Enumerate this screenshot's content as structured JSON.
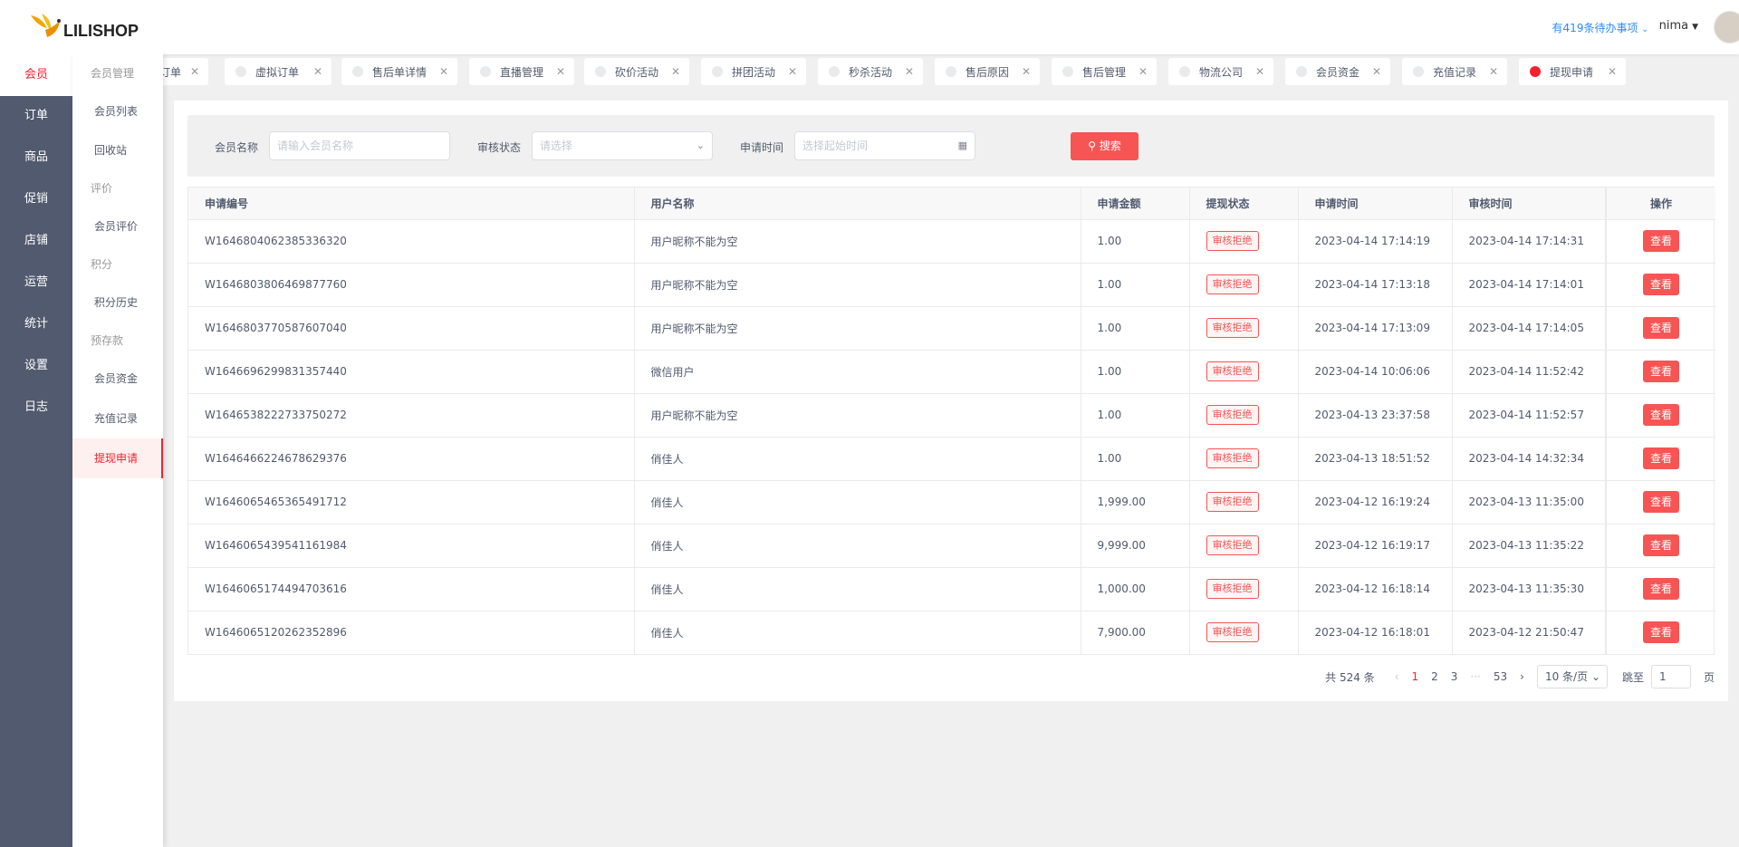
{
  "logo": {
    "text": "LILISHOP"
  },
  "header": {
    "todo": "有419条待办事项",
    "user": "nima"
  },
  "nav": {
    "items": [
      "会员",
      "订单",
      "商品",
      "促销",
      "店铺",
      "运营",
      "统计",
      "设置",
      "日志"
    ],
    "active_index": 0
  },
  "submenu": {
    "group1": "会员管理",
    "member_list": "会员列表",
    "recycle": "回收站",
    "group2": "评价",
    "member_review": "会员评价",
    "group3": "积分",
    "points_history": "积分历史",
    "group4": "预存款",
    "member_funds": "会员资金",
    "recharge": "充值记录",
    "withdraw": "提现申请"
  },
  "tabs": [
    "订单",
    "虚拟订单",
    "售后单详情",
    "直播管理",
    "砍价活动",
    "拼团活动",
    "秒杀活动",
    "售后原因",
    "售后管理",
    "物流公司",
    "会员资金",
    "充值记录",
    "提现申请"
  ],
  "search": {
    "member_label": "会员名称",
    "member_placeholder": "请输入会员名称",
    "status_label": "审核状态",
    "status_placeholder": "请选择",
    "time_label": "申请时间",
    "time_placeholder": "选择起始时间",
    "button": "搜索"
  },
  "table": {
    "headers": [
      "申请编号",
      "用户名称",
      "申请金额",
      "提现状态",
      "申请时间",
      "审核时间",
      "操作"
    ],
    "action_label": "查看",
    "rows": [
      [
        "W1646804062385336320",
        "用户昵称不能为空",
        "1.00",
        "审核拒绝",
        "2023-04-14 17:14:19",
        "2023-04-14 17:14:31"
      ],
      [
        "W1646803806469877760",
        "用户昵称不能为空",
        "1.00",
        "审核拒绝",
        "2023-04-14 17:13:18",
        "2023-04-14 17:14:01"
      ],
      [
        "W1646803770587607040",
        "用户昵称不能为空",
        "1.00",
        "审核拒绝",
        "2023-04-14 17:13:09",
        "2023-04-14 17:14:05"
      ],
      [
        "W1646696299831357440",
        "微信用户",
        "1.00",
        "审核拒绝",
        "2023-04-14 10:06:06",
        "2023-04-14 11:52:42"
      ],
      [
        "W1646538222733750272",
        "用户昵称不能为空",
        "1.00",
        "审核拒绝",
        "2023-04-13 23:37:58",
        "2023-04-14 11:52:57"
      ],
      [
        "W1646466224678629376",
        "俏佳人",
        "1.00",
        "审核拒绝",
        "2023-04-13 18:51:52",
        "2023-04-14 14:32:34"
      ],
      [
        "W1646065465365491712",
        "俏佳人",
        "1,999.00",
        "审核拒绝",
        "2023-04-12 16:19:24",
        "2023-04-13 11:35:00"
      ],
      [
        "W1646065439541161984",
        "俏佳人",
        "9,999.00",
        "审核拒绝",
        "2023-04-12 16:19:17",
        "2023-04-13 11:35:22"
      ],
      [
        "W1646065174494703616",
        "俏佳人",
        "1,000.00",
        "审核拒绝",
        "2023-04-12 16:18:14",
        "2023-04-13 11:35:30"
      ],
      [
        "W1646065120262352896",
        "俏佳人",
        "7,900.00",
        "审核拒绝",
        "2023-04-12 16:18:01",
        "2023-04-12 21:50:47"
      ]
    ]
  },
  "pagination": {
    "total": "共 524 条",
    "pages": [
      "1",
      "2",
      "3",
      "···",
      "53"
    ],
    "current": "1",
    "page_size": "10 条/页",
    "jump_label": "跳至",
    "jump_value": "1",
    "page_unit": "页"
  },
  "colors": {
    "accent": "#f75454",
    "nav_bg": "#515a6e",
    "link": "#2d8cf0"
  }
}
